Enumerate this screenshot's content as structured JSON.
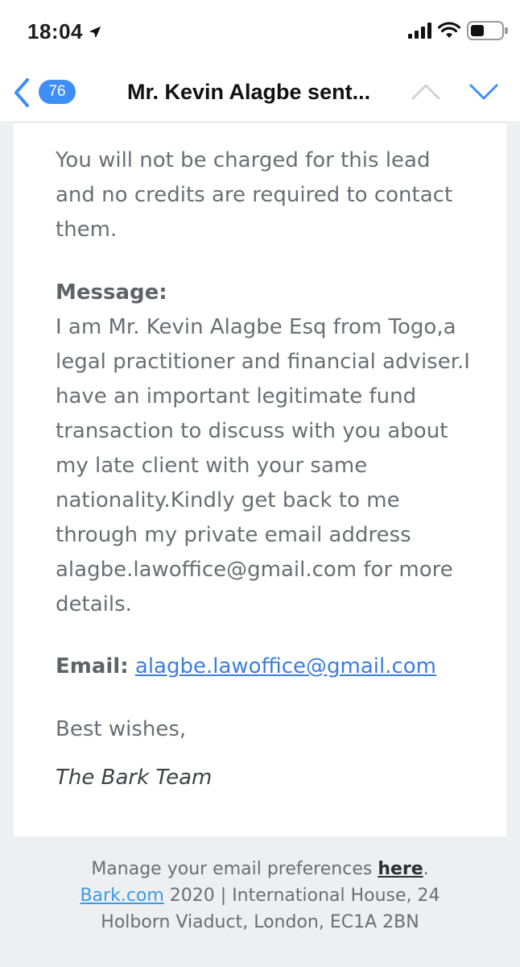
{
  "status_bar": {
    "time": "18:04",
    "icons": [
      "location-arrow-icon",
      "signal-icon",
      "wifi-icon",
      "battery-icon"
    ],
    "battery_level": 0.45
  },
  "nav": {
    "back_count": "76",
    "title": "Mr. Kevin Alagbe  sent...",
    "accent_color": "#3f8ef5"
  },
  "email": {
    "intro": "You will not be charged for this lead and no credits are required to contact them.",
    "message_label": "Message:",
    "message_text": "I am Mr. Kevin Alagbe Esq from Togo,a legal practitioner and financial adviser.I have an important legitimate fund transaction to discuss with you about my late client with your same nationality.Kindly get back to me through my private email address alagbe.lawoffice@gmail.com for more details.",
    "email_label": "Email:",
    "email_link": "alagbe.lawoffice@gmail.com",
    "closing": "Best wishes,",
    "signature": "The Bark Team"
  },
  "footer": {
    "prefs_prefix": "Manage your email preferences ",
    "prefs_link": "here",
    "prefs_suffix": ".",
    "company_link": "Bark.com",
    "address_line1": " 2020 | International House, 24",
    "address_line2": "Holborn Viaduct, London, EC1A 2BN"
  }
}
